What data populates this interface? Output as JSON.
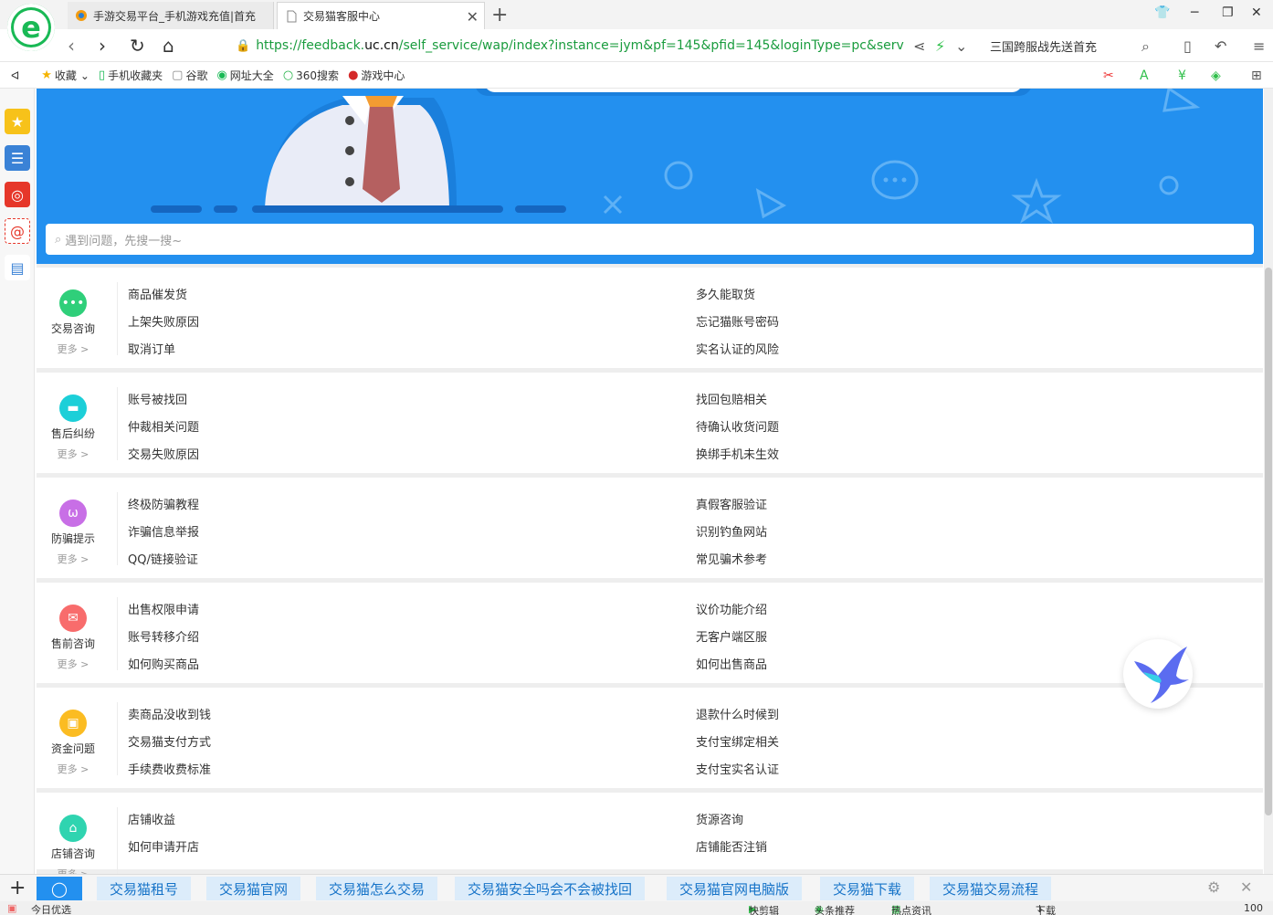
{
  "tabs": [
    {
      "title": "手游交易平台_手机游戏充值|首充"
    },
    {
      "title": "交易猫客服中心"
    }
  ],
  "address": {
    "url_prefix": "https://feedback.",
    "url_domain": "uc.cn",
    "url_path": "/self_service/wap/index?instance=jym&pf=145&pfid=145&loginType=pc&service_t",
    "hot_search": "三国跨服战先送首充"
  },
  "bookmarks": [
    {
      "label": "收藏",
      "icon": "star-icon"
    },
    {
      "label": "手机收藏夹",
      "icon": "phone-icon"
    },
    {
      "label": "谷歌",
      "icon": "page-icon"
    },
    {
      "label": "网址大全",
      "icon": "globe-icon"
    },
    {
      "label": "360搜索",
      "icon": "ring-icon"
    },
    {
      "label": "游戏中心",
      "icon": "game-icon"
    }
  ],
  "search": {
    "placeholder": "遇到问题，先搜一搜~"
  },
  "sections": [
    {
      "category": "交易咨询",
      "more": "更多 >",
      "color": "#2fcf7a",
      "left": [
        "商品催发货",
        "上架失败原因",
        "取消订单"
      ],
      "right": [
        "多久能取货",
        "忘记猫账号密码",
        "实名认证的风险"
      ]
    },
    {
      "category": "售后纠纷",
      "more": "更多 >",
      "color": "#1ccfd8",
      "left": [
        "账号被找回",
        "仲裁相关问题",
        "交易失败原因"
      ],
      "right": [
        "找回包赔相关",
        "待确认收货问题",
        "换绑手机未生效"
      ]
    },
    {
      "category": "防骗提示",
      "more": "更多 >",
      "color": "#c86fe6",
      "left": [
        "终极防骗教程",
        "诈骗信息举报",
        "QQ/链接验证"
      ],
      "right": [
        "真假客服验证",
        "识别钓鱼网站",
        "常见骗术参考"
      ]
    },
    {
      "category": "售前咨询",
      "more": "更多 >",
      "color": "#f86c6c",
      "left": [
        "出售权限申请",
        "账号转移介绍",
        "如何购买商品"
      ],
      "right": [
        "议价功能介绍",
        "无客户端区服",
        "如何出售商品"
      ]
    },
    {
      "category": "资金问题",
      "more": "更多 >",
      "color": "#fbbc22",
      "left": [
        "卖商品没收到钱",
        "交易猫支付方式",
        "手续费收费标准"
      ],
      "right": [
        "退款什么时候到",
        "支付宝绑定相关",
        "支付宝实名认证"
      ]
    },
    {
      "category": "店铺咨询",
      "more": "更多 >",
      "color": "#2fd4b0",
      "left": [
        "店铺收益",
        "如何申请开店"
      ],
      "right": [
        "货源咨询",
        "店铺能否注销"
      ]
    }
  ],
  "adbar": {
    "items": [
      "交易猫租号",
      "交易猫官网",
      "交易猫怎么交易",
      "交易猫安全吗会不会被找回",
      "交易猫官网电脑版",
      "交易猫下载",
      "交易猫交易流程"
    ]
  },
  "statusbar": {
    "left": "今日优选",
    "items": [
      "快剪辑",
      "头条推荐",
      "热点资讯",
      "下载",
      "100"
    ]
  }
}
